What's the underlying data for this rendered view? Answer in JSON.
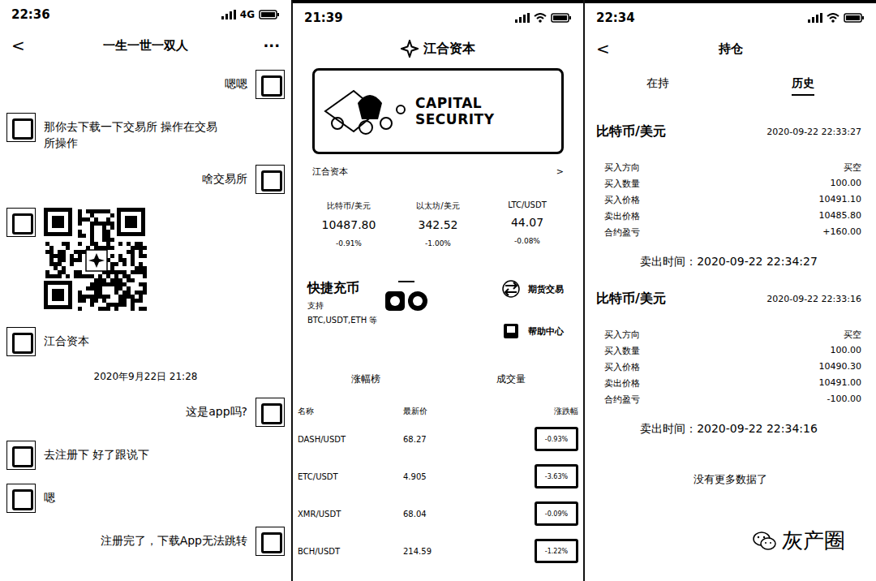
{
  "chat": {
    "status": {
      "time": "22:36",
      "network": "4G"
    },
    "back": "<",
    "title": "一生一世一双人",
    "more": "···",
    "messages": [
      {
        "kind": "text",
        "side": "right",
        "text": "嗯嗯"
      },
      {
        "kind": "text",
        "side": "left",
        "text": "那你去下载一下交易所 操作在交易所操作"
      },
      {
        "kind": "text",
        "side": "right",
        "text": "啥交易所"
      },
      {
        "kind": "qr",
        "side": "left"
      },
      {
        "kind": "text",
        "side": "left",
        "text": "江合资本"
      },
      {
        "kind": "time",
        "side": "center",
        "text": "2020年9月22日 21:28"
      },
      {
        "kind": "text",
        "side": "right",
        "text": "这是app吗?"
      },
      {
        "kind": "text",
        "side": "left",
        "text": "去注册下 好了跟说下"
      },
      {
        "kind": "text",
        "side": "left",
        "text": "嗯"
      },
      {
        "kind": "text",
        "side": "right",
        "text": "注册完了，下载App无法跳转"
      }
    ]
  },
  "exchange": {
    "status": {
      "time": "21:39"
    },
    "logo": "江合资本",
    "banner": "CAPITAL SECURITY",
    "link": {
      "label": "江合资本",
      "arrow": ">"
    },
    "tickers": [
      {
        "name": "比特币/美元",
        "price": "10487.80",
        "change": "-0.91%"
      },
      {
        "name": "以太坊/美元",
        "price": "342.52",
        "change": "-1.00%"
      },
      {
        "name": "LTC/USDT",
        "price": "44.07",
        "change": "-0.08%"
      }
    ],
    "quick": {
      "title": "快捷充币",
      "support": "支持",
      "coins": "BTC,USDT,ETH 等"
    },
    "actions": [
      "期货交易",
      "帮助中心"
    ],
    "tabs": [
      "涨幅榜",
      "成交量"
    ],
    "columns": [
      "名称",
      "最新价",
      "涨跌幅"
    ],
    "rows": [
      {
        "name": "DASH/USDT",
        "price": "68.27",
        "change": "-0.93%"
      },
      {
        "name": "ETC/USDT",
        "price": "4.905",
        "change": "-3.63%"
      },
      {
        "name": "XMR/USDT",
        "price": "68.04",
        "change": "-0.09%"
      },
      {
        "name": "BCH/USDT",
        "price": "214.59",
        "change": "-1.22%"
      }
    ]
  },
  "positions": {
    "status": {
      "time": "22:34"
    },
    "back": "<",
    "title": "持仓",
    "tabs": [
      {
        "label": "在持",
        "selected": false
      },
      {
        "label": "历史",
        "selected": true
      }
    ],
    "records": [
      {
        "name": "比特币/美元",
        "date": "2020-09-22 22:33:27",
        "rows": [
          [
            "买入方向",
            "买空"
          ],
          [
            "买入数量",
            "100.00"
          ],
          [
            "买入价格",
            "10491.10"
          ],
          [
            "卖出价格",
            "10485.80"
          ],
          [
            "合约盈亏",
            "+160.00"
          ]
        ],
        "sell_time": "卖出时间：2020-09-22 22:34:27"
      },
      {
        "name": "比特币/美元",
        "date": "2020-09-22 22:33:16",
        "rows": [
          [
            "买入方向",
            "买空"
          ],
          [
            "买入数量",
            "100.00"
          ],
          [
            "买入价格",
            "10490.30"
          ],
          [
            "卖出价格",
            "10491.00"
          ],
          [
            "合约盈亏",
            "-100.00"
          ]
        ],
        "sell_time": "卖出时间：2020-09-22 22:34:16"
      }
    ],
    "footer": "没有更多数据了"
  },
  "watermark": "灰产圈"
}
